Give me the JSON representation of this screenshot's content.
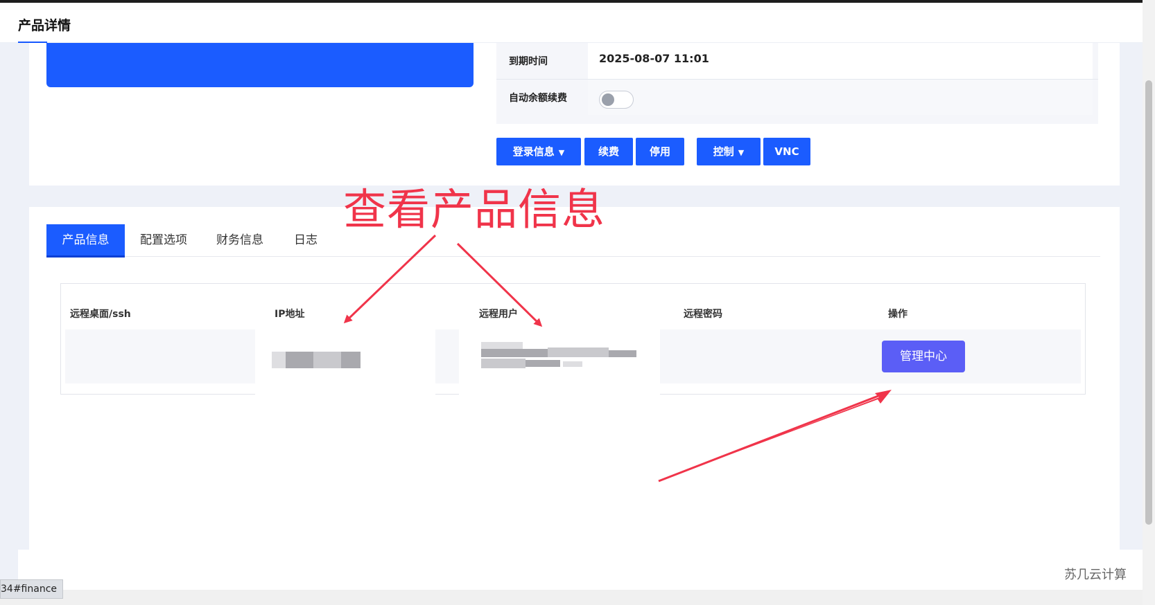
{
  "header": {
    "title": "产品详情"
  },
  "info": {
    "expire_label": "到期时间",
    "expire_value": "2025-08-07 11:01",
    "auto_renew_label": "自动余额续费",
    "auto_renew_on": false
  },
  "actions": {
    "login_info": "登录信息",
    "renew": "续费",
    "disable": "停用",
    "control": "控制",
    "vnc": "VNC"
  },
  "tabs": [
    {
      "label": "产品信息",
      "active": true
    },
    {
      "label": "配置选项",
      "active": false
    },
    {
      "label": "财务信息",
      "active": false
    },
    {
      "label": "日志",
      "active": false
    }
  ],
  "table": {
    "headers": [
      "远程桌面/ssh",
      "IP地址",
      "远程用户",
      "远程密码",
      "操作"
    ],
    "row": {
      "remote_desktop": "",
      "ip": "",
      "user": "",
      "password": "",
      "action_label": "管理中心"
    }
  },
  "annotation": {
    "text": "查看产品信息",
    "color": "#f0344a"
  },
  "footer": {
    "brand": "苏几云计算"
  },
  "status_bar": {
    "url": "34#finance"
  },
  "colors": {
    "primary": "#1b5cff",
    "manage_button": "#5b5ef6"
  }
}
